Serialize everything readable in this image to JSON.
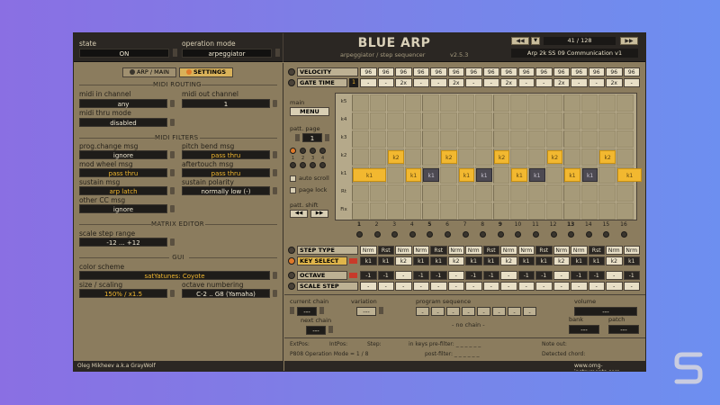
{
  "header": {
    "state_label": "state",
    "state_value": "ON",
    "opmode_label": "operation mode",
    "opmode_value": "arpeggiator",
    "title": "BLUE ARP",
    "subtitle": "arpeggiator / step sequencer",
    "version": "v2.5.3",
    "preset_counter": "41 / 128",
    "preset_name": "Arp 2k SS 09 Communication v1"
  },
  "left": {
    "tab_arp": "ARP / MAIN",
    "tab_settings": "SETTINGS",
    "midi_routing_title": "MIDI ROUTING",
    "midi_in_label": "midi in channel",
    "midi_in_value": "any",
    "midi_out_label": "midi out channel",
    "midi_out_value": "1",
    "midi_thru_label": "midi thru mode",
    "midi_thru_value": "disabled",
    "midi_filters_title": "MIDI FILTERS",
    "prog_label": "prog.change msg",
    "prog_value": "ignore",
    "pitch_label": "pitch bend msg",
    "pitch_value": "pass thru",
    "modw_label": "mod wheel msg",
    "modw_value": "pass thru",
    "after_label": "aftertouch msg",
    "after_value": "pass thru",
    "sustain_label": "sustain msg",
    "sustain_value": "arp latch",
    "sustpol_label": "sustain polarity",
    "sustpol_value": "normally low (-)",
    "othercc_label": "other CC msg",
    "othercc_value": "ignore",
    "matrix_title": "MATRIX EDITOR",
    "scale_range_label": "scale step range",
    "scale_range_value": "-12 ... +12",
    "gui_title": "GUI",
    "color_label": "color scheme",
    "color_value": "satYatunes: Coyote",
    "size_label": "size / scaling",
    "size_value": "150% / x1.5",
    "octnum_label": "octave numbering",
    "octnum_value": "C-2 .. G8 (Yamaha)",
    "credit": "Oleg Mikheev a.k.a GrayWolf"
  },
  "seq": {
    "velocity_label": "VELOCITY",
    "velocity": [
      "96",
      "96",
      "96",
      "96",
      "96",
      "96",
      "96",
      "96",
      "96",
      "96",
      "96",
      "96",
      "96",
      "96",
      "96",
      "96"
    ],
    "gate_label": "GATE TIME",
    "gate_num": "1",
    "gate": [
      "-",
      "-",
      "2x",
      "-",
      "-",
      "2x",
      "-",
      "-",
      "2x",
      "-",
      "-",
      "2x",
      "-",
      "-",
      "2x",
      "-"
    ],
    "row_labels": [
      "k5",
      "k4",
      "k3",
      "k2",
      "k1",
      "Rt",
      "Fix"
    ],
    "columns": [
      "1",
      "2",
      "3",
      "4",
      "5",
      "6",
      "7",
      "8",
      "9",
      "10",
      "11",
      "12",
      "13",
      "14",
      "15",
      "16"
    ],
    "main_label": "main",
    "menu_label": "MENU",
    "patt_page_label": "patt. page",
    "patt_page_value": "1",
    "page_nums": [
      "1",
      "2",
      "3",
      "4"
    ],
    "auto_scroll": "auto scroll",
    "page_lock": "page lock",
    "patt_shift": "patt. shift",
    "notes": [
      {
        "col": 1,
        "row": "k1",
        "label": "k1",
        "style": "gold"
      },
      {
        "col": 3,
        "row": "k2",
        "label": "k2",
        "style": "gold"
      },
      {
        "col": 4,
        "row": "k1",
        "label": "k1",
        "style": "gold"
      },
      {
        "col": 5,
        "row": "k1",
        "label": "k1",
        "style": "dark"
      },
      {
        "col": 6,
        "row": "k2",
        "label": "k2",
        "style": "gold"
      },
      {
        "col": 7,
        "row": "k1",
        "label": "k1",
        "style": "gold"
      },
      {
        "col": 8,
        "row": "k1",
        "label": "k1",
        "style": "dark"
      },
      {
        "col": 9,
        "row": "k2",
        "label": "k2",
        "style": "gold"
      },
      {
        "col": 10,
        "row": "k1",
        "label": "k1",
        "style": "gold"
      },
      {
        "col": 11,
        "row": "k1",
        "label": "k1",
        "style": "dark"
      },
      {
        "col": 12,
        "row": "k2",
        "label": "k2",
        "style": "gold"
      },
      {
        "col": 13,
        "row": "k1",
        "label": "k1",
        "style": "gold"
      },
      {
        "col": 14,
        "row": "k1",
        "label": "k1",
        "style": "dark"
      },
      {
        "col": 15,
        "row": "k2",
        "label": "k2",
        "style": "gold"
      },
      {
        "col": 16,
        "row": "k1",
        "label": "k1",
        "style": "gold"
      }
    ],
    "step_type_label": "STEP TYPE",
    "step_type": [
      "Nrm",
      "Rst",
      "Nrm",
      "Nrm",
      "Rst",
      "Nrm",
      "Nrm",
      "Rst",
      "Nrm",
      "Nrm",
      "Rst",
      "Nrm",
      "Nrm",
      "Rst",
      "Nrm",
      "Nrm"
    ],
    "key_select_label": "KEY SELECT",
    "key_select": [
      "k1",
      "k1",
      "k2",
      "k1",
      "k1",
      "k2",
      "k1",
      "k1",
      "k2",
      "k1",
      "k1",
      "k2",
      "k1",
      "k1",
      "k2",
      "k1"
    ],
    "octave_label": "OCTAVE",
    "octave": [
      "-1",
      "-1",
      "-",
      "-1",
      "-1",
      "-",
      "-1",
      "-1",
      "-",
      "-1",
      "-1",
      "-",
      "-1",
      "-1",
      "-",
      "-1"
    ],
    "scale_step_label": "SCALE STEP",
    "scale_step": [
      "-",
      "-",
      "-",
      "-",
      "-",
      "-",
      "-",
      "-",
      "-",
      "-",
      "-",
      "-",
      "-",
      "-",
      "-",
      "-"
    ]
  },
  "chain": {
    "current_chain_label": "current chain",
    "current_chain_value": "---",
    "variation_label": "variation",
    "variation_value": "---",
    "program_sequence_label": "program sequence",
    "program_sequence": [
      "-",
      "-",
      "-",
      "-",
      "-",
      "-",
      "-",
      "-"
    ],
    "no_chain": "- no chain -",
    "next_chain_label": "next chain",
    "next_chain_value": "---",
    "volume_label": "volume",
    "volume_value": "---",
    "bank_label": "bank",
    "bank_value": "---",
    "patch_label": "patch",
    "patch_value": "---"
  },
  "status": {
    "extpos": "ExtPos:",
    "intpos": "IntPos:",
    "step": "Step:",
    "in_keys": "in keys pre-filter:  _ _ _ _ _ _",
    "post_filter": "post-filter:  _ _ _ _ _ _",
    "note_out": "Note out:",
    "detected_chord": "Detected chord:",
    "p808": "P808 Operation Mode = 1 / 8",
    "website": "www.omg-instruments.com"
  },
  "colors": {
    "accent": "#f2b830",
    "panel": "#8b7c5e",
    "dark": "#1f1d1a",
    "orange_led": "#e07a2a"
  }
}
